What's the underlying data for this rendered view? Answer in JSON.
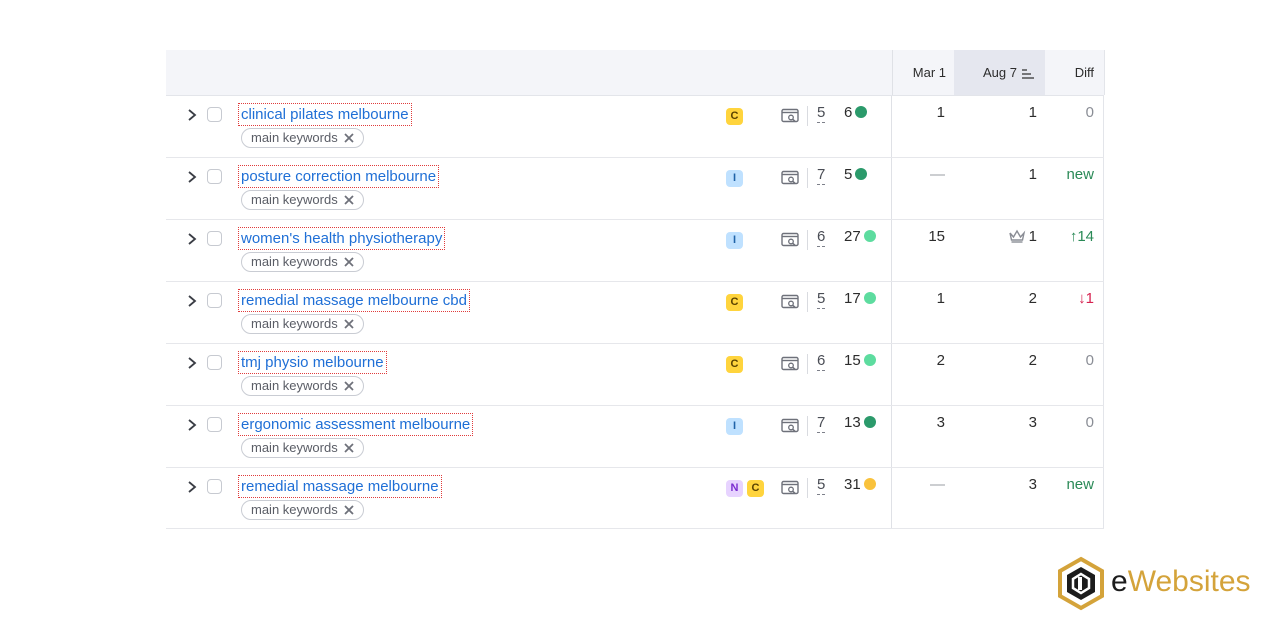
{
  "header": {
    "col_mar": "Mar 1",
    "col_aug": "Aug 7",
    "col_diff": "Diff"
  },
  "rows": [
    {
      "keyword": "clinical pilates melbourne",
      "tag": "main keywords",
      "intents": [
        "C"
      ],
      "results": "5",
      "kd": "6",
      "kd_color": "#2b9a6b",
      "pos_mar": "1",
      "pos_aug": "1",
      "diff": "0",
      "diff_type": "zero"
    },
    {
      "keyword": "posture correction melbourne",
      "tag": "main keywords",
      "intents": [
        "I"
      ],
      "results": "7",
      "kd": "5",
      "kd_color": "#2b9a6b",
      "pos_mar": "—",
      "pos_aug": "1",
      "diff": "new",
      "diff_type": "new"
    },
    {
      "keyword": "women's health physiotherapy",
      "tag": "main keywords",
      "intents": [
        "I"
      ],
      "results": "6",
      "kd": "27",
      "kd_color": "#5ddc9f",
      "pos_mar": "15",
      "pos_aug": "1",
      "aug_crown": true,
      "diff": "↑14",
      "diff_type": "up"
    },
    {
      "keyword": "remedial massage melbourne cbd",
      "tag": "main keywords",
      "intents": [
        "C"
      ],
      "results": "5",
      "kd": "17",
      "kd_color": "#5ddc9f",
      "pos_mar": "1",
      "pos_aug": "2",
      "diff": "↓1",
      "diff_type": "down"
    },
    {
      "keyword": "tmj physio melbourne",
      "tag": "main keywords",
      "intents": [
        "C"
      ],
      "results": "6",
      "kd": "15",
      "kd_color": "#5ddc9f",
      "pos_mar": "2",
      "pos_aug": "2",
      "diff": "0",
      "diff_type": "zero"
    },
    {
      "keyword": "ergonomic assessment melbourne",
      "tag": "main keywords",
      "intents": [
        "I"
      ],
      "results": "7",
      "kd": "13",
      "kd_color": "#2b9a6b",
      "pos_mar": "3",
      "pos_aug": "3",
      "diff": "0",
      "diff_type": "zero"
    },
    {
      "keyword": "remedial massage melbourne",
      "tag": "main keywords",
      "intents": [
        "N",
        "C"
      ],
      "results": "5",
      "kd": "31",
      "kd_color": "#f9c23c",
      "pos_mar": "—",
      "pos_aug": "3",
      "diff": "new",
      "diff_type": "new"
    }
  ],
  "icons": {
    "expand": "chevron-right-icon",
    "serp": "serp-features-icon",
    "remove_tag": "close-icon",
    "sort": "sort-icon",
    "crown": "crown-icon"
  },
  "logo": {
    "text_prefix": "e",
    "text_rest": "Websites",
    "color": "#d4a33a"
  }
}
